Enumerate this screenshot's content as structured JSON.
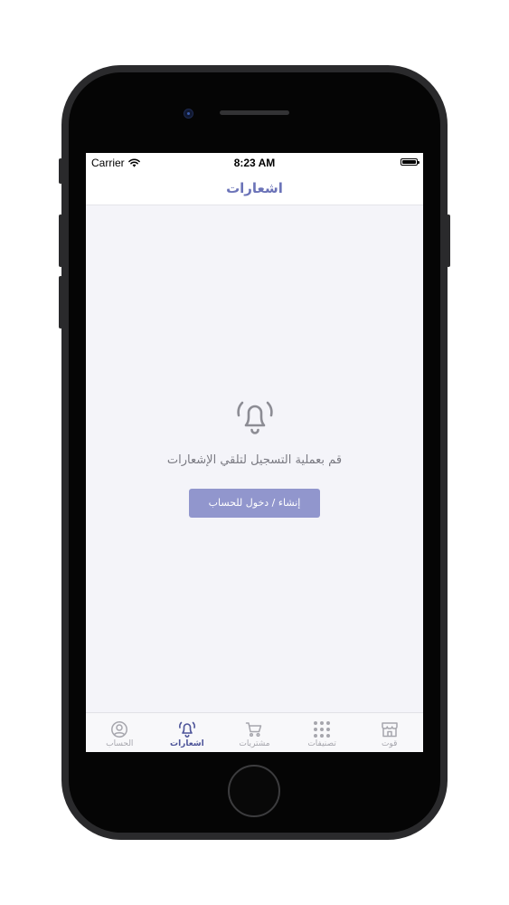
{
  "status_bar": {
    "carrier": "Carrier",
    "time": "8:23 AM",
    "wifi_icon": "wifi-icon",
    "battery_icon": "battery-icon"
  },
  "nav": {
    "title": "اشعارات"
  },
  "empty_state": {
    "icon": "bell-ringing-icon",
    "message": "قم بعملية التسجيل لتلقي الإشعارات",
    "button_label": "إنشاء / دخول للحساب"
  },
  "tabs": [
    {
      "label": "الحساب",
      "icon": "user-circle-icon",
      "active": false
    },
    {
      "label": "اشعارات",
      "icon": "bell-icon",
      "active": true
    },
    {
      "label": "مشتريات",
      "icon": "cart-icon",
      "active": false
    },
    {
      "label": "تصنيفات",
      "icon": "grid-icon",
      "active": false
    },
    {
      "label": "قوت",
      "icon": "store-icon",
      "active": false
    }
  ],
  "colors": {
    "accent": "#6b73b8",
    "button": "#9196cd",
    "tab_active": "#4d5499",
    "tab_inactive": "#a6a6ad",
    "background": "#f4f4f9"
  }
}
